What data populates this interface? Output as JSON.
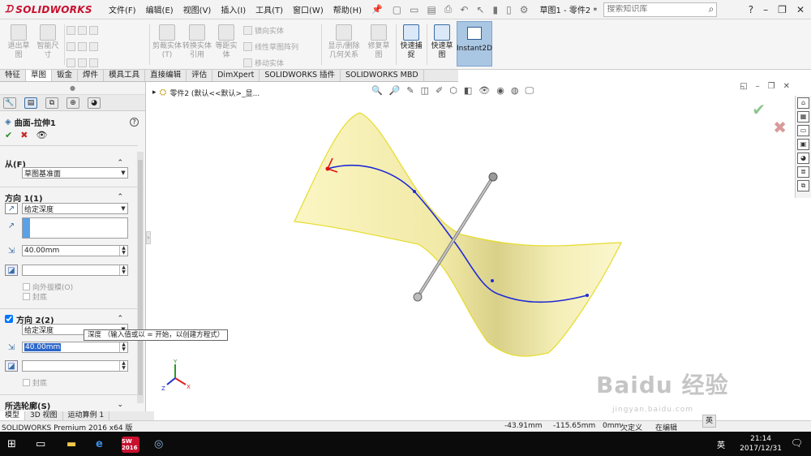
{
  "app": {
    "logo_text": "SOLIDWORKS",
    "menus": [
      "文件(F)",
      "编辑(E)",
      "视图(V)",
      "插入(I)",
      "工具(T)",
      "窗口(W)",
      "帮助(H)"
    ],
    "doc_title": "草图1 - 零件2 *",
    "search_placeholder": "搜索知识库"
  },
  "ribbon": {
    "exit_sketch": "退出草图",
    "smart_dim": "智能尺寸",
    "trim": "剪裁实体(T)",
    "convert": "转换实体引用",
    "offset": "等距实体",
    "mirror": "镜向实体",
    "linear_pattern": "线性草图阵列",
    "move": "移动实体",
    "display_relations": "显示/删除几何关系",
    "repair": "修复草图",
    "quick_snap": "快速捕捉",
    "rapid_sketch": "快速草图",
    "instant2d": "Instant2D"
  },
  "tabs": [
    "特征",
    "草图",
    "钣金",
    "焊件",
    "模具工具",
    "直接编辑",
    "评估",
    "DimXpert",
    "SOLIDWORKS 插件",
    "SOLIDWORKS MBD"
  ],
  "active_tab_index": 1,
  "property_manager": {
    "feature_name": "曲面-拉伸1",
    "from_section": "从(F)",
    "from_value": "草图基准面",
    "dir1_title": "方向 1(1)",
    "dir1_end": "给定深度",
    "dir1_depth": "40.00mm",
    "draft_outward": "向外拔模(O)",
    "cap_end_1": "封底",
    "dir2_title": "方向 2(2)",
    "dir2_end": "给定深度",
    "dir2_depth": "40.00mm",
    "cap_end_2": "封底",
    "selected_contours": "所选轮廓(S)"
  },
  "tooltip": "深度 （输入值或以 = 开始，以创建方程式）",
  "breadcrumb": "零件2 (默认<<默认>_显...",
  "bottom_tabs": [
    "模型",
    "3D 视图",
    "运动算例 1"
  ],
  "status": {
    "product": "SOLIDWORKS Premium 2016 x64 版",
    "x": "-43.91mm",
    "y": "-115.65mm",
    "z": "0mm",
    "state": "欠定义",
    "mode": "在编辑"
  },
  "taskbar": {
    "sw_badge": "SW 2016",
    "ime": "英",
    "time": "21:14",
    "date": "2017/12/31"
  },
  "watermark": {
    "brand": "Baidu 经验",
    "url": "jingyan.baidu.com"
  },
  "ime_tray": "英"
}
